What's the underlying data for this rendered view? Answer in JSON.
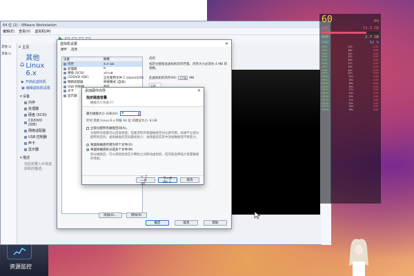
{
  "vmware": {
    "window_title": "64 位 (2) - VMware Workstation",
    "menu": [
      "编辑(E)",
      "查看(V)",
      "虚拟机(M)"
    ],
    "tab_label": "主页",
    "vm_name": "其他 Linux 6.x",
    "actions": [
      "开启此虚拟机",
      "编辑虚拟机设置"
    ],
    "devices_section": "设备",
    "devices": [
      "内存",
      "处理器",
      "硬盘 (SCSI)",
      "CD/DVD (IDE)",
      "网络适配器",
      "USB 控制器",
      "声卡",
      "显示器"
    ],
    "description_section": "描述",
    "description_placeholder": "在此处键入对该虚拟机的描述。",
    "sidebar_items": [
      "其他 Li",
      "其他 Li"
    ]
  },
  "settings_dialog": {
    "title": "虚拟机设置",
    "tabs": [
      "硬件",
      "选项"
    ],
    "columns": [
      "设备",
      "摘要"
    ],
    "hardware": [
      {
        "device": "内存",
        "summary": "4.4 GB",
        "selected": true
      },
      {
        "device": "处理器",
        "summary": "8",
        "selected": false
      },
      {
        "device": "硬盘 (SCSI)",
        "summary": "20 GB",
        "selected": false
      },
      {
        "device": "CD/DVD (IDE)",
        "summary": "正在使用文件 C:\\Users\\LTASR\\...",
        "selected": false
      },
      {
        "device": "网络适配器",
        "summary": "桥接模式 (自动)",
        "selected": false
      },
      {
        "device": "USB 控制器",
        "summary": "存在",
        "selected": false
      },
      {
        "device": "声卡",
        "summary": "自动检测",
        "selected": false
      },
      {
        "device": "显示器",
        "summary": "自动检测",
        "selected": false
      }
    ],
    "add_button": "添加(A)...",
    "remove_button": "移除(R)",
    "memory_title": "内存",
    "memory_desc": "指定分配给此虚拟机的内存量。内存大小必须为 4 MB 的倍数。",
    "memory_label": "此虚拟机的内存(M):",
    "memory_value": "4708",
    "memory_unit": "MB",
    "memory_scale_top": "128 GB",
    "ok": "确定",
    "cancel": "取消",
    "help": "帮助"
  },
  "wizard": {
    "title": "添加硬件向导",
    "heading": "指定磁盘容量",
    "subheading": "磁盘大小为多少?",
    "size_label": "最大磁盘大小 (GB)(S):",
    "size_value": "8",
    "recommend": "针对 其他 Linux 6.x 内核 64 位 的建议大小: 8 GB",
    "opt_allocate": "立即分配所有磁盘空间(A)。",
    "opt_allocate_desc": "分配所有容量可以提高性能，但要求所有物理磁盘空间立即可用。如果不立即分配所有空间，虚拟磁盘的空间最初很小，会随着您向其中添加数据而不断变大。",
    "opt_single": "将虚拟磁盘存储为单个文件(O)",
    "opt_multi": "将虚拟磁盘拆分成多个文件(M)",
    "opt_multi_desc": "拆分磁盘后，可以更轻松地在计算机之间移动虚拟机，但可能会降低大容量磁盘的性能。",
    "back": "< 上一步(B)",
    "next": "下一步(N) >",
    "cancel": "取消"
  },
  "monitor": {
    "fps_label": "FPS",
    "fps_value": "60",
    "ram_label": "RAM",
    "ram_value": "12.3 GB",
    "ram_pct": 0.78,
    "ram2_label": "RAM",
    "ram2_value": "2.7 GB",
    "cpu_label": "CPU",
    "cpu_value": "52 %",
    "cores": [
      {
        "name": "CPU1",
        "mhz": "3287",
        "pct": "23%"
      },
      {
        "name": "CPU2",
        "mhz": "3287",
        "pct": "18%"
      },
      {
        "name": "CPU3",
        "mhz": "3287",
        "pct": "41%"
      },
      {
        "name": "CPU4",
        "mhz": "3287",
        "pct": "12%"
      },
      {
        "name": "CPU5",
        "mhz": "3287",
        "pct": "35%"
      },
      {
        "name": "CPU6",
        "mhz": "3287",
        "pct": "27%"
      },
      {
        "name": "CPU7",
        "mhz": "3287",
        "pct": "19%"
      },
      {
        "name": "CPU8",
        "mhz": "3287",
        "pct": "44%"
      },
      {
        "name": "CPU9",
        "mhz": "3287",
        "pct": "22%"
      },
      {
        "name": "CPU10",
        "mhz": "3287",
        "pct": "31%"
      },
      {
        "name": "CPU11",
        "mhz": "3287",
        "pct": "15%"
      },
      {
        "name": "CPU12",
        "mhz": "3287",
        "pct": "28%"
      },
      {
        "name": "CPU13",
        "mhz": "3287",
        "pct": "39%"
      },
      {
        "name": "CPU14",
        "mhz": "3287",
        "pct": "17%"
      },
      {
        "name": "CPU15",
        "mhz": "3287",
        "pct": "24%"
      },
      {
        "name": "CPU16",
        "mhz": "3287",
        "pct": "33%"
      },
      {
        "name": "CPU17",
        "mhz": "3287",
        "pct": "21%"
      },
      {
        "name": "CPU18",
        "mhz": "3287",
        "pct": "29%"
      },
      {
        "name": "CPU19",
        "mhz": "3287",
        "pct": "16%"
      },
      {
        "name": "CPU20",
        "mhz": "3287",
        "pct": "38%"
      }
    ]
  },
  "desktop": {
    "resource_monitor_label": "资源监控"
  }
}
